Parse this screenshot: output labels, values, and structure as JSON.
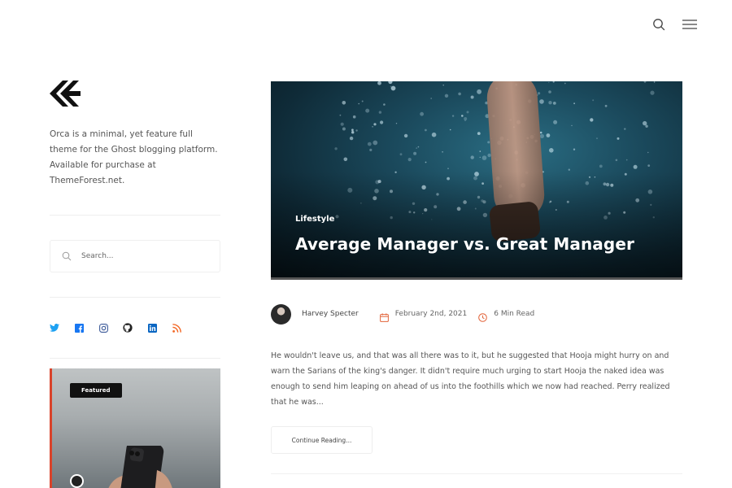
{
  "header": {
    "search_icon": "search-icon",
    "menu_icon": "hamburger-menu-icon"
  },
  "sidebar": {
    "logo_icon": "orca-logo-icon",
    "description": "Orca is a minimal, yet feature full theme for the Ghost blogging platform. Available for purchase at ThemeForest.net.",
    "search": {
      "placeholder": "Search..."
    },
    "socials": [
      {
        "icon": "twitter-icon",
        "color": "#1da1f2"
      },
      {
        "icon": "facebook-icon",
        "color": "#1877f2"
      },
      {
        "icon": "instagram-icon",
        "color": "#3b5998"
      },
      {
        "icon": "github-icon",
        "color": "#222222"
      },
      {
        "icon": "linkedin-icon",
        "color": "#0a66c2"
      },
      {
        "icon": "rss-icon",
        "color": "#f26522"
      }
    ],
    "featured_card": {
      "badge": "Featured",
      "accent": "#d9432b"
    }
  },
  "post": {
    "category": "Lifestyle",
    "title": "Average Manager vs. Great Manager",
    "author": "Harvey Specter",
    "date": "February 2nd, 2021",
    "read_time": "6 Min Read",
    "meta_icon_color": "#e2643a",
    "excerpt": "He wouldn't leave us, and that was all there was to it, but he suggested that Hooja might hurry on and warn the Sarians of the king's danger. It didn't require much urging to start Hooja the naked idea was enough to send him leaping on ahead of us into the foothills which we now had reached. Perry realized that he was...",
    "continue_label": "Continue Reading..."
  }
}
